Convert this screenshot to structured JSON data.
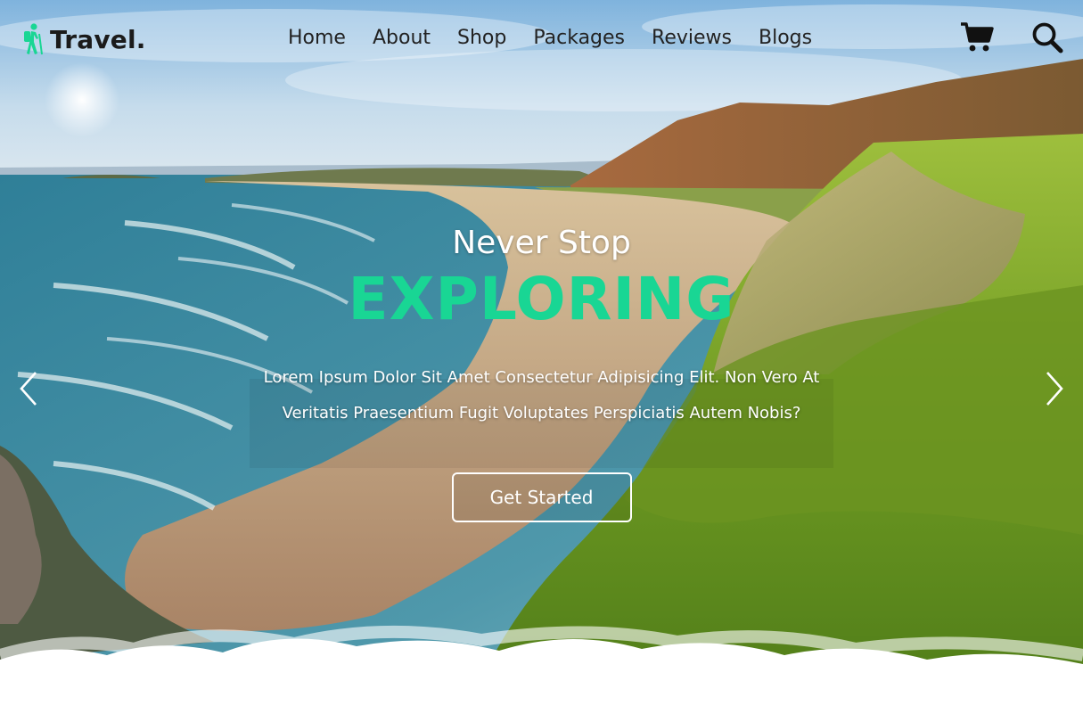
{
  "brand": {
    "name": "Travel.",
    "icon": "hiker-icon",
    "accent": "#19d694"
  },
  "nav": {
    "links": [
      {
        "label": "Home"
      },
      {
        "label": "About"
      },
      {
        "label": "Shop"
      },
      {
        "label": "Packages"
      },
      {
        "label": "Reviews"
      },
      {
        "label": "Blogs"
      }
    ],
    "icons": [
      "cart-icon",
      "search-icon"
    ]
  },
  "hero": {
    "subtitle": "Never Stop",
    "title": "EXPLORING",
    "description": "Lorem Ipsum Dolor Sit Amet Consectetur Adipisicing Elit. Non Vero At Veritatis Praesentium Fugit Voluptates Perspiciatis Autem Nobis?",
    "cta_label": "Get Started"
  },
  "slider": {
    "prev_icon": "chevron-left-icon",
    "next_icon": "chevron-right-icon"
  },
  "colors": {
    "title_green": "#19d694",
    "text_dark": "#222222",
    "white": "#ffffff"
  }
}
